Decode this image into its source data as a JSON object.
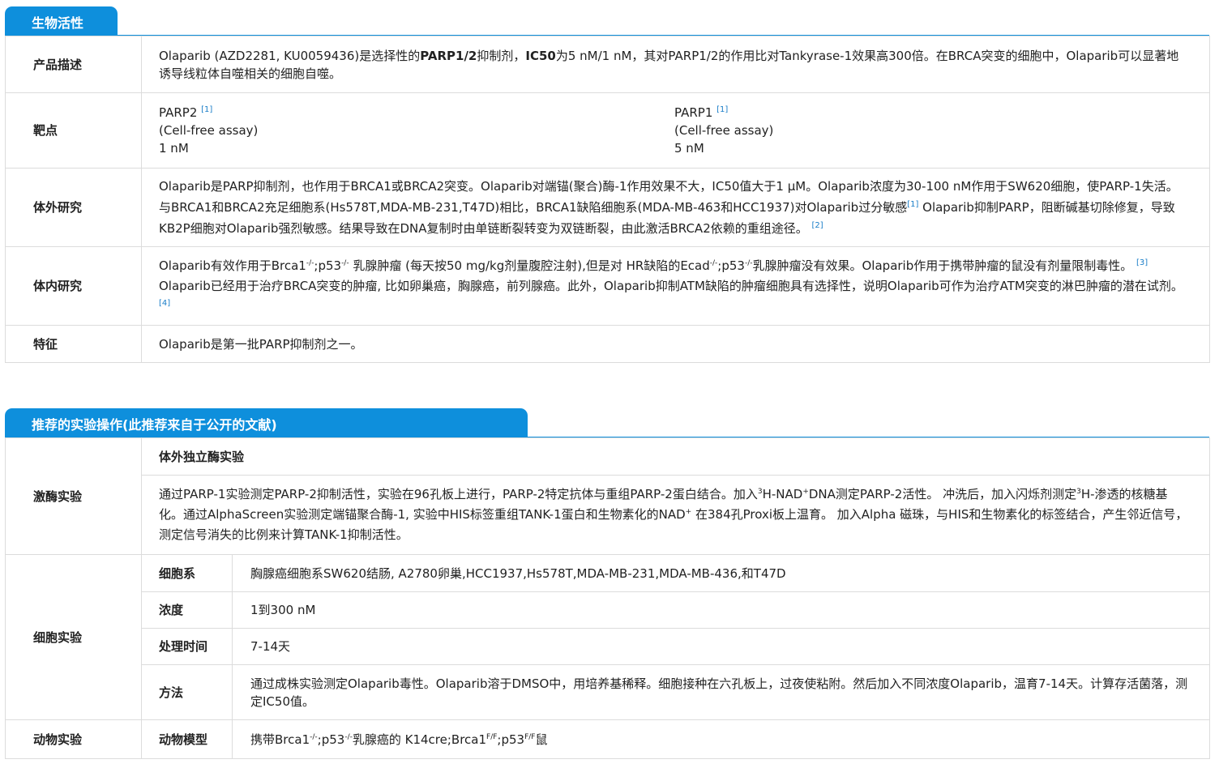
{
  "section1": {
    "title": "生物活性",
    "rows": {
      "desc": {
        "label": "产品描述",
        "t1": "Olaparib (AZD2281, KU0059436)是选择性的",
        "t1b": "PARP1/2",
        "t2": "抑制剂，",
        "t2b": "IC50",
        "t3": "为5 nM/1 nM，其对PARP1/2的作用比对Tankyrase-1效果高300倍。在BRCA突变的细胞中，Olaparib可以显著地诱导线粒体自噬相关的细胞自噬。"
      },
      "target": {
        "label": "靶点",
        "items": [
          {
            "name": "PARP2",
            "ref": "[1]",
            "assay": "(Cell-free assay)",
            "value": "1 nM"
          },
          {
            "name": "PARP1",
            "ref": "[1]",
            "assay": "(Cell-free assay)",
            "value": "5 nM"
          }
        ]
      },
      "invitro": {
        "label": "体外研究",
        "t1": "Olaparib是PARP抑制剂，也作用于BRCA1或BRCA2突变。Olaparib对端锚(聚合)酶-1作用效果不大，IC50值大于1 μM。Olaparib浓度为30-100 nM作用于SW620细胞，使PARP-1失活。与BRCA1和BRCA2充足细胞系(Hs578T,MDA-MB-231,T47D)相比，BRCA1缺陷细胞系(MDA-MB-463和HCC1937)对Olaparib过分敏感",
        "ref1": "[1]",
        "t2": " Olaparib抑制PARP，阻断碱基切除修复，导致KB2P细胞对Olaparib强烈敏感。结果导致在DNA复制时由单链断裂转变为双链断裂，由此激活BRCA2依赖的重组途径。",
        "ref2": "[2]"
      },
      "invivo": {
        "label": "体内研究",
        "t1": "Olaparib有效作用于Brca1",
        "sup1": "-/-",
        "t2": ";p53",
        "sup2": "-/-",
        "t3": " 乳腺肿瘤 (每天按50 mg/kg剂量腹腔注射),但是对 HR缺陷的Ecad",
        "sup3": "-/-",
        "t4": ";p53",
        "sup4": "-/-",
        "t5": "乳腺肿瘤没有效果。Olaparib作用于携带肿瘤的鼠没有剂量限制毒性。",
        "ref3": "[3]",
        "t6": "Olaparib已经用于治疗BRCA突变的肿瘤, 比如卵巢癌，胸腺癌，前列腺癌。此外，Olaparib抑制ATM缺陷的肿瘤细胞具有选择性，说明Olaparib可作为治疗ATM突变的淋巴肿瘤的潜在试剂。",
        "ref4": "[4]"
      },
      "feature": {
        "label": "特征",
        "text": "Olaparib是第一批PARP抑制剂之一。"
      }
    }
  },
  "section2": {
    "title": "推荐的实验操作(此推荐来自于公开的文献)",
    "kinase": {
      "label": "激酶实验",
      "subheader": "体外独立酶实验",
      "t1": "通过PARP-1实验测定PARP-2抑制活性，实验在96孔板上进行，PARP-2特定抗体与重组PARP-2蛋白结合。加入",
      "sup1": "3",
      "t2": "H-NAD",
      "sup2": "+",
      "t3": "DNA测定PARP-2活性。 冲洗后，加入闪烁剂测定",
      "sup3": "3",
      "t4": "H-渗透的核糖基化。通过AlphaScreen实验测定端锚聚合酶-1, 实验中HIS标签重组TANK-1蛋白和生物素化的NAD",
      "sup4": "+",
      "t5": " 在384孔Proxi板上温育。 加入Alpha 磁珠，与HIS和生物素化的标签结合，产生邻近信号，测定信号消失的比例来计算TANK-1抑制活性。"
    },
    "cell": {
      "label": "细胞实验",
      "rows": [
        {
          "label": "细胞系",
          "value": "胸腺癌细胞系SW620结肠, A2780卵巢,HCC1937,Hs578T,MDA-MB-231,MDA-MB-436,和T47D"
        },
        {
          "label": "浓度",
          "value": "1到300 nM"
        },
        {
          "label": "处理时间",
          "value": "7-14天"
        },
        {
          "label": "方法",
          "value": "通过成株实验测定Olaparib毒性。Olaparib溶于DMSO中，用培养基稀释。细胞接种在六孔板上，过夜使粘附。然后加入不同浓度Olaparib，温育7-14天。计算存活菌落，测定IC50值。"
        }
      ]
    },
    "animal": {
      "label": "动物实验",
      "sublabel": "动物模型",
      "t1": "携带Brca1",
      "sup1": "-/-",
      "t2": ";p53",
      "sup2": "-/-",
      "t3": "乳腺癌的 K14cre;Brca1",
      "sup3": "F/F",
      "t4": ";p53",
      "sup4": "F/F",
      "t5": "鼠"
    }
  }
}
